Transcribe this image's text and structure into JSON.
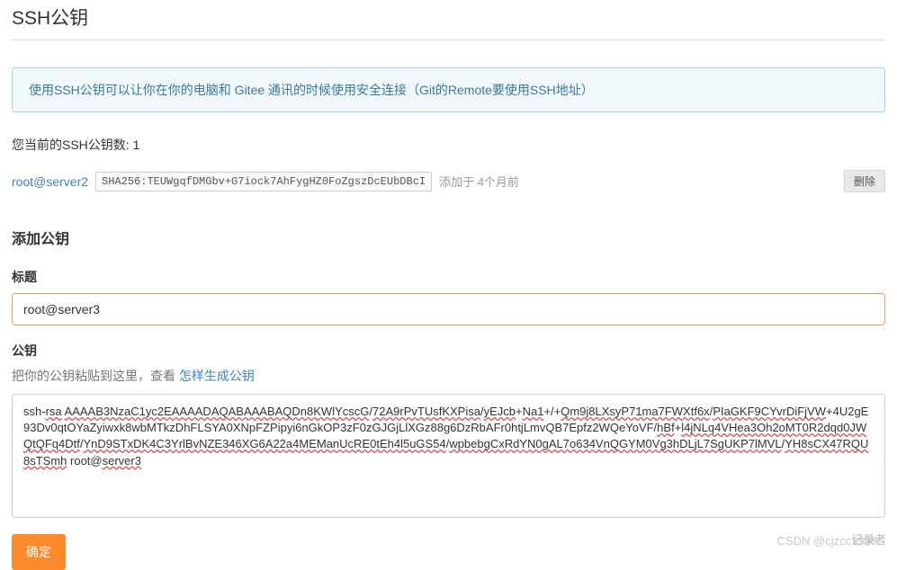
{
  "page": {
    "title": "SSH公钥",
    "info_text": "使用SSH公钥可以让你在你的电脑和 Gitee 通讯的时候使用安全连接（Git的Remote要使用SSH地址）",
    "count_label": "您当前的SSH公钥数: 1"
  },
  "key_row": {
    "name": "root@server2",
    "fingerprint": "SHA256:TEUWgqfDMGbv+G7iock7AhFygHZ0FoZgszDcEUbDBcI",
    "added_text": "添加于 4个月前",
    "delete_label": "删除"
  },
  "add_section": {
    "heading": "添加公钥",
    "title_label": "标题",
    "title_value": "root@server3",
    "pubkey_label": "公钥",
    "hint_prefix": "把你的公钥粘贴到这里，查看 ",
    "hint_link": "怎样生成公钥",
    "pubkey_value": "ssh-rsa AAAAB3NzaC1yc2EAAAADAQABAAABAQDn8KWlYcscG/72A9rPvTUsfKXPisa/yEJcb+Na1+/+Qm9j8LXsyP71ma7FWXtf6x/PIaGKF9CYvrDiFjVW+4U2gE93Dv0qtOYaZyiwxk8wbMTkzDhFLSYA0XNpFZPipyi6nGkOP3zF0zGJGjLlXGz88g6DzRbAFr0htjLmvQB7Epfz2WQeYoVF/hBf+l4jNLq4VHea3Oh2oMT0R2dqd0JWQtQFq4Dtf/YnD9STxDK4C3YrlBvNZE346XG6A22a4MEManUcRE0tEh4l5uGS54/wpbebgCxRdYN0gAL7o634VnQGYM0Vg3hDLjL7SgUKP7lMVL/YH8sCX47RQU8sTSmh root@server3",
    "submit_label": "确定"
  },
  "watermark": {
    "left": "CSDN @cjzcc1998",
    "right": "记录者"
  }
}
